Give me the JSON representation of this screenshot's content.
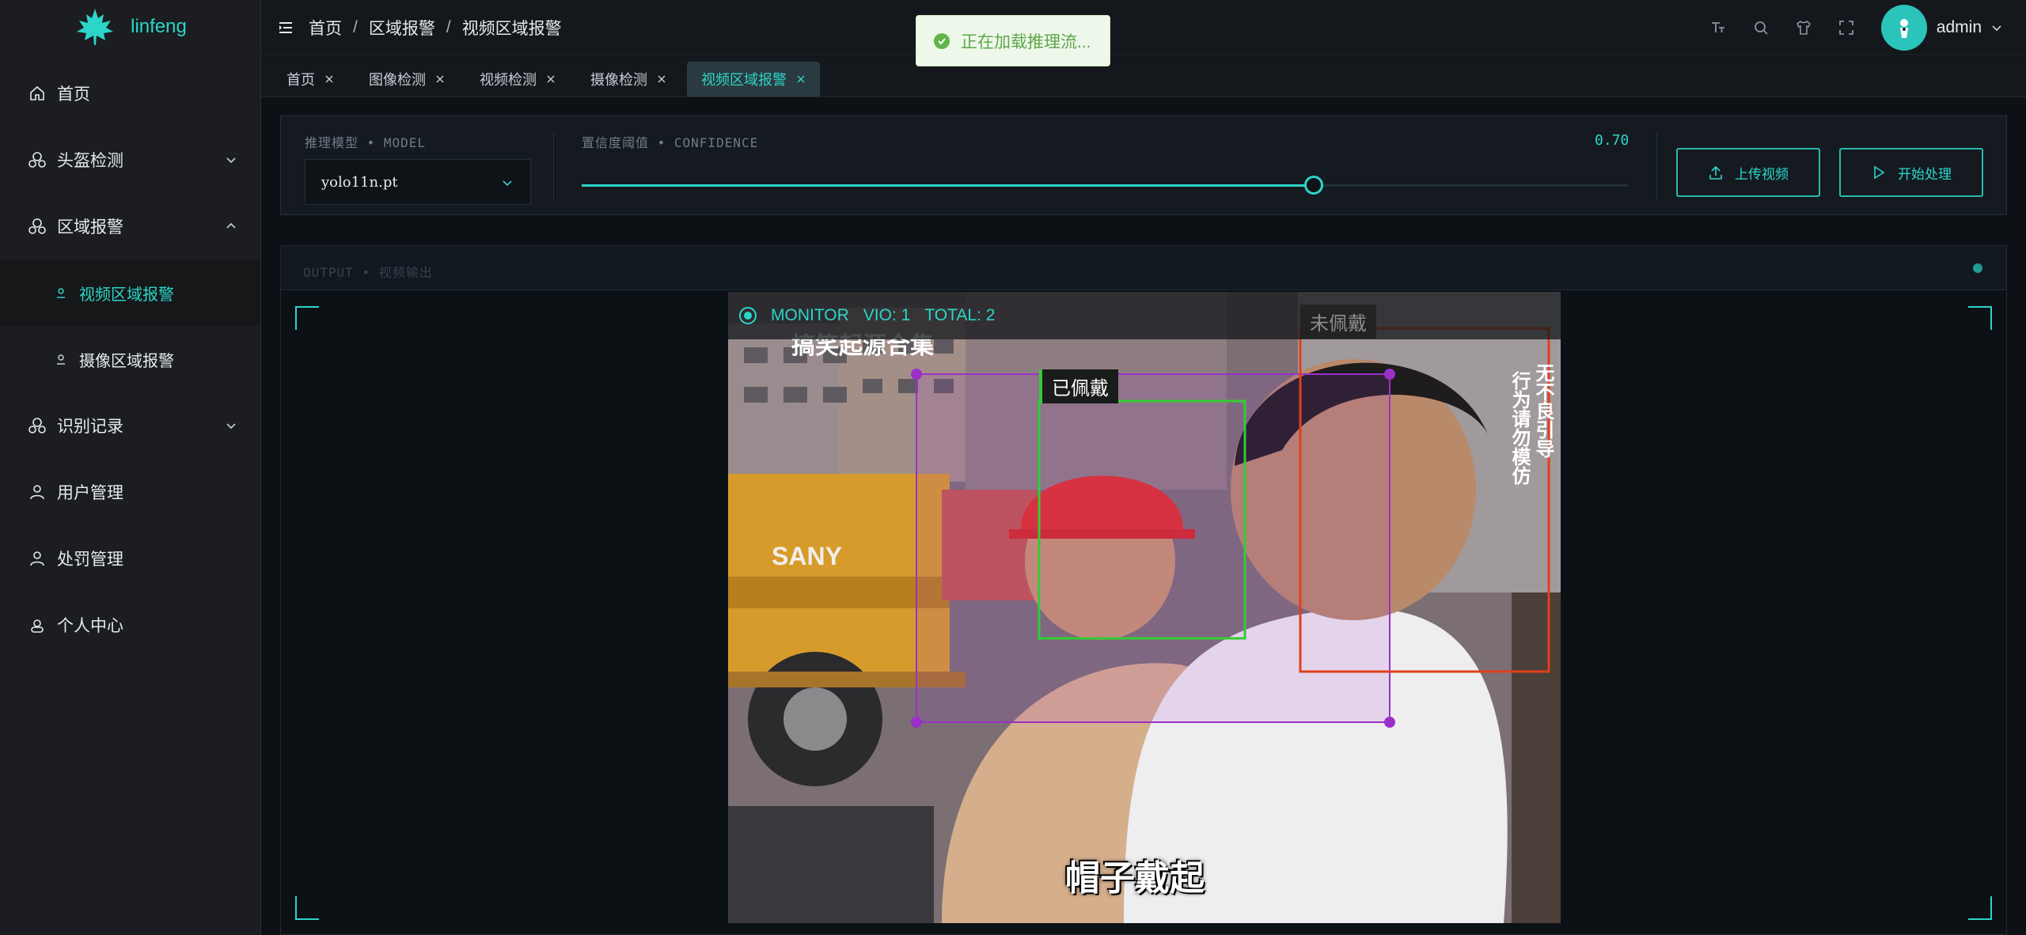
{
  "app": {
    "name": "linfeng",
    "accent": "#2bd6c9"
  },
  "sidebar": {
    "items": [
      {
        "label": "首页",
        "icon": "home-icon"
      },
      {
        "label": "头盔检测",
        "icon": "helmet-icon",
        "expanded": false
      },
      {
        "label": "区域报警",
        "icon": "helmet-icon",
        "expanded": true,
        "children": [
          {
            "label": "视频区域报警",
            "active": true
          },
          {
            "label": "摄像区域报警",
            "active": false
          }
        ]
      },
      {
        "label": "识别记录",
        "icon": "helmet-icon",
        "expanded": false
      },
      {
        "label": "用户管理",
        "icon": "user-icon"
      },
      {
        "label": "处罚管理",
        "icon": "user-icon"
      },
      {
        "label": "个人中心",
        "icon": "user-circle-icon"
      }
    ]
  },
  "header": {
    "breadcrumb": [
      "首页",
      "区域报警",
      "视频区域报警"
    ],
    "user": "admin"
  },
  "toast": {
    "text": "正在加载推理流...",
    "type": "success"
  },
  "tabs": [
    {
      "label": "首页",
      "active": false
    },
    {
      "label": "图像检测",
      "active": false
    },
    {
      "label": "视频检测",
      "active": false
    },
    {
      "label": "摄像检测",
      "active": false
    },
    {
      "label": "视频区域报警",
      "active": true
    }
  ],
  "controls": {
    "model_label": "推理模型 • MODEL",
    "model_value": "yolo11n.pt",
    "confidence_label": "置信度阈值 • CONFIDENCE",
    "confidence_value": "0.70",
    "confidence": 0.7,
    "upload_label": "上传视频",
    "start_label": "开始处理"
  },
  "output": {
    "label": "OUTPUT • 视频输出",
    "hud": {
      "monitor": "MONITOR",
      "vio": "VIO: 1",
      "total": "TOTAL: 2"
    },
    "detections": [
      {
        "label": "已佩戴",
        "color": "#33cc33"
      },
      {
        "label": "未佩戴",
        "color": "#e0401a"
      }
    ],
    "region_color": "#9a30c8",
    "caption": "帽子戴起"
  }
}
